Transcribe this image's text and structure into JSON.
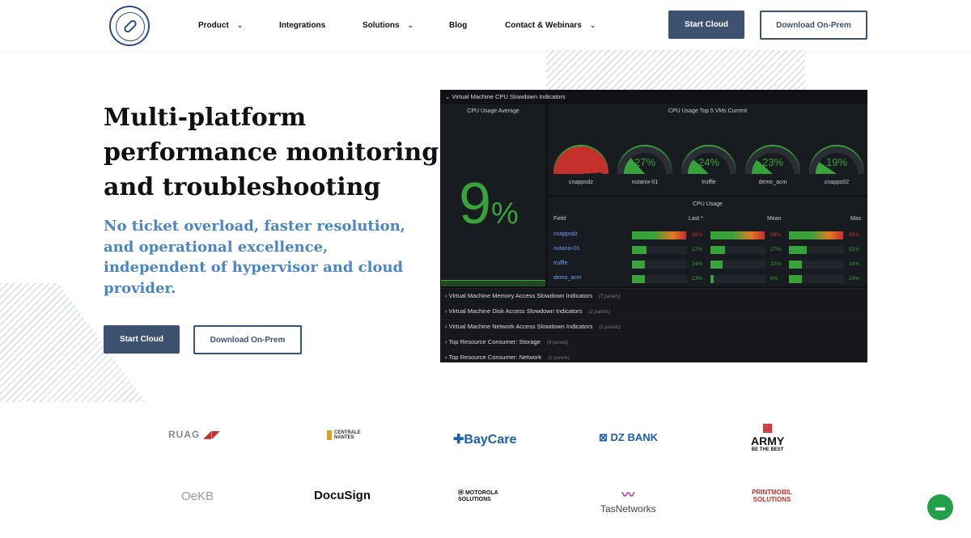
{
  "nav": {
    "items": [
      {
        "label": "Product",
        "chevron": true
      },
      {
        "label": "Integrations"
      },
      {
        "label": "Solutions",
        "chevron": true
      },
      {
        "label": "Blog"
      },
      {
        "label": "Contact & Webinars",
        "chevron": true
      }
    ],
    "start_cloud": "Start Cloud",
    "download": "Download On-Prem"
  },
  "hero": {
    "title": "Multi-platform performance monitoring and  troubleshooting",
    "subtitle": "No ticket overload, faster resolution, and operational excellence, independent of hypervisor and cloud provider.",
    "start_cloud": "Start Cloud",
    "download": "Download On-Prem"
  },
  "dashboard": {
    "section": "Virtual Machine CPU Slowdown Indicators",
    "avg_title": "CPU Usage Average",
    "avg_value": "9",
    "avg_unit": "%",
    "top5_title": "CPU Usage Top 5 VMs Current",
    "gauges": [
      {
        "name": "cnappsdz",
        "value": "98%",
        "pct": 98
      },
      {
        "name": "nutanix-01",
        "value": "27%",
        "pct": 27
      },
      {
        "name": "truffle",
        "value": "24%",
        "pct": 24
      },
      {
        "name": "demo_acm",
        "value": "23%",
        "pct": 23
      },
      {
        "name": "cnapps02",
        "value": "19%",
        "pct": 19
      }
    ],
    "table_title": "CPU Usage",
    "columns": [
      "Field",
      "Last *",
      "Mean",
      "Max"
    ],
    "rows": [
      {
        "field": "cnappsdz",
        "last": "98%",
        "mean": "98%",
        "max": "99%",
        "l": 98,
        "m": 98,
        "x": 99
      },
      {
        "field": "nutanix-01",
        "last": "27%",
        "mean": "27%",
        "max": "32%",
        "l": 27,
        "m": 27,
        "x": 32
      },
      {
        "field": "truffle",
        "last": "24%",
        "mean": "22%",
        "max": "24%",
        "l": 24,
        "m": 22,
        "x": 24
      },
      {
        "field": "demo_acm",
        "last": "23%",
        "mean": "6%",
        "max": "24%",
        "l": 23,
        "m": 6,
        "x": 24
      }
    ],
    "collapsed": [
      {
        "title": "Virtual Machine Memory Access Slowdown Indicators",
        "count": "(7 panels)"
      },
      {
        "title": "Virtual Machine Disk Access Slowdown Indicators",
        "count": "(2 panels)"
      },
      {
        "title": "Virtual Machine Network Access Slowdown Indicators",
        "count": "(2 panels)"
      },
      {
        "title": "Top Resource Consumer: Storage",
        "count": "(4 panels)"
      },
      {
        "title": "Top Resource Consumer: Network",
        "count": "(2 panels)"
      }
    ]
  },
  "logos": [
    "RUAG",
    "CENTRALE NANTES",
    "BayCare",
    "DZ BANK",
    "ARMY",
    "BE THE BEST",
    "OeKB",
    "DocuSign",
    "MOTOROLA SOLUTIONS",
    "TasNetworks",
    "PRINTMOBIL SOLUTIONS"
  ],
  "colors": {
    "green": "#37a339",
    "red": "#c4312c",
    "accent": "#3d5270",
    "subtitle": "#4a86c5"
  }
}
